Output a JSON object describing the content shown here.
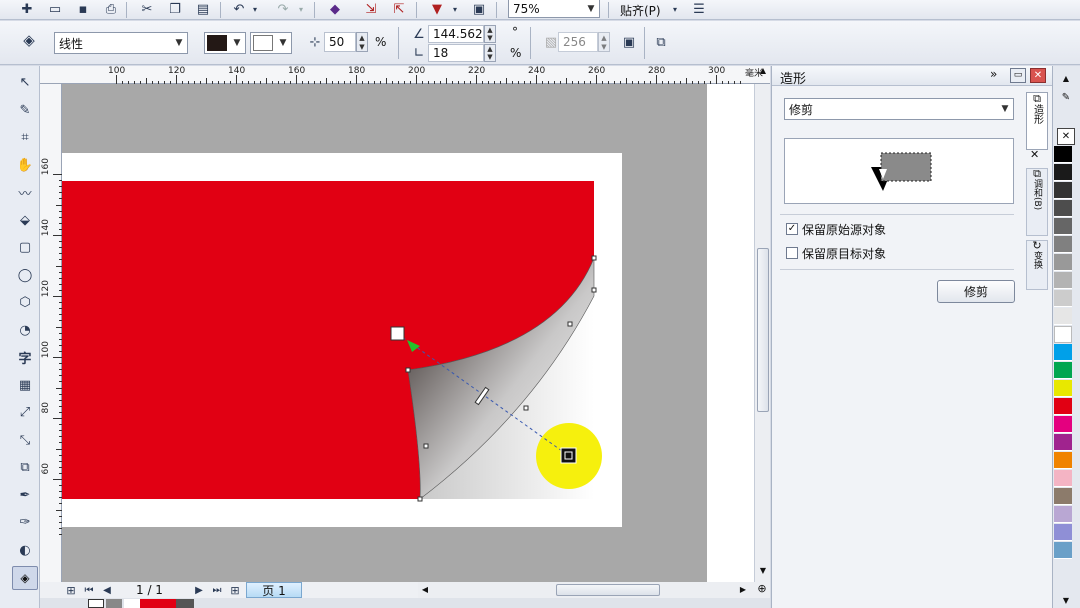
{
  "toolbar": {
    "zoom_value": "75%",
    "snap_label": "贴齐(P)",
    "line_style": "线性",
    "opacity_value": "50",
    "percent_sign": "%",
    "angle_value": "144.562",
    "degree_sign": "°",
    "edge_value": "18",
    "edge_percent": "%",
    "steps_value": "256"
  },
  "ruler": {
    "h_labels": [
      "100",
      "120",
      "140",
      "160",
      "180",
      "200",
      "220",
      "240",
      "260",
      "280",
      "300"
    ],
    "h_unit": "毫米",
    "v_labels": [
      "160",
      "140",
      "120",
      "100",
      "80",
      "60"
    ]
  },
  "docker": {
    "title": "造形",
    "operation": "修剪",
    "keep_source_label": "保留原始源对象",
    "keep_source_checked": true,
    "keep_target_label": "保留原目标对象",
    "keep_target_checked": false,
    "apply_label": "修剪",
    "tabs": [
      "造形",
      "调和(B)",
      "变换"
    ]
  },
  "pagebar": {
    "page_count": "1 / 1",
    "page_tab": "页 1"
  },
  "colors": {
    "red_fill": "#e10013",
    "highlight": "#f5ef00",
    "palette": [
      "#000000",
      "#1a1a1a",
      "#333333",
      "#4d4d4d",
      "#666666",
      "#808080",
      "#999999",
      "#b3b3b3",
      "#cccccc",
      "#e6e6e6",
      "#ffffff",
      "#00a0e9",
      "#00a650",
      "#e8e800",
      "#e10013",
      "#e4007f",
      "#a0238e",
      "#f08300",
      "#f4b4c4",
      "#8c7b6b",
      "#b9a7d3",
      "#8f8fd6",
      "#6aa0c8"
    ]
  }
}
